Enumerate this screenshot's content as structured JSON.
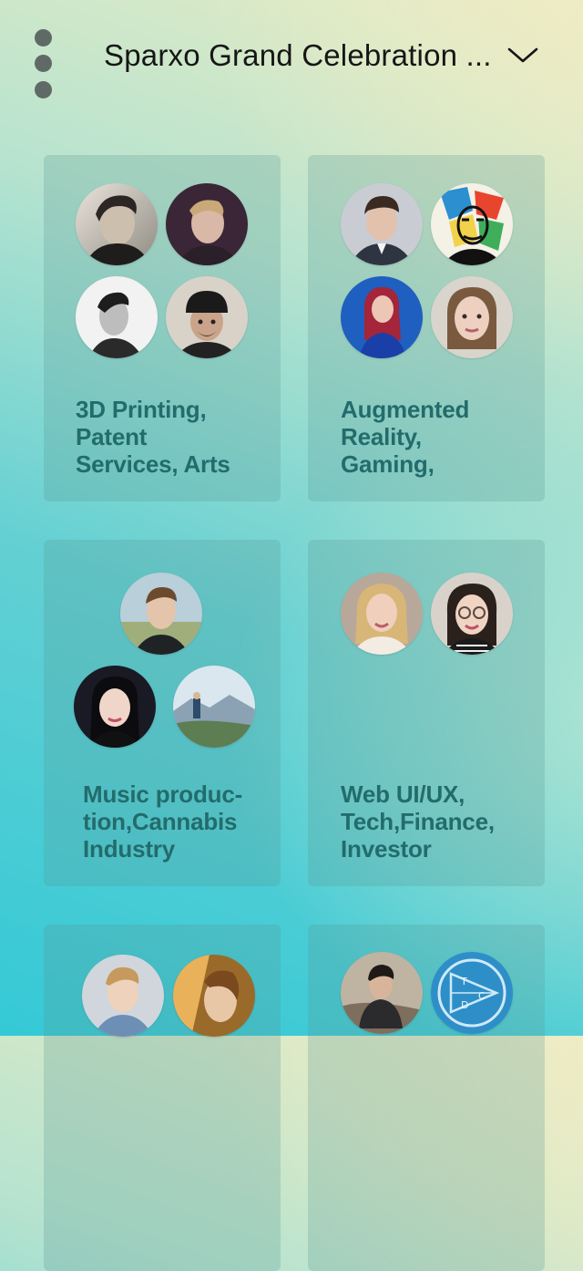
{
  "header": {
    "title": "Sparxo Grand Celebration ...",
    "menu_icon": "vertical-dots-icon",
    "dropdown_icon": "chevron-down-icon"
  },
  "cards": [
    {
      "label_lines": [
        "3D Printing,",
        "Patent",
        "Services, Arts"
      ],
      "avatar_count": 4
    },
    {
      "label_lines": [
        "Augmented",
        "Reality,",
        "Gaming,"
      ],
      "avatar_count": 4
    },
    {
      "label_lines": [
        "Music produc-",
        "tion,Cannabis",
        "Industry"
      ],
      "avatar_count": 3
    },
    {
      "label_lines": [
        "Web UI/UX,",
        "Tech,Finance,",
        "Investor"
      ],
      "avatar_count": 2
    },
    {
      "label_lines": [],
      "avatar_count": 2
    },
    {
      "label_lines": [],
      "avatar_count": 2,
      "logo_letters": [
        "T",
        "C",
        "D"
      ]
    }
  ],
  "colors": {
    "label": "#236c6c",
    "title": "#161616",
    "menu_dots": "#5f6a66",
    "card_bg": "rgba(88,150,145,0.26)"
  }
}
